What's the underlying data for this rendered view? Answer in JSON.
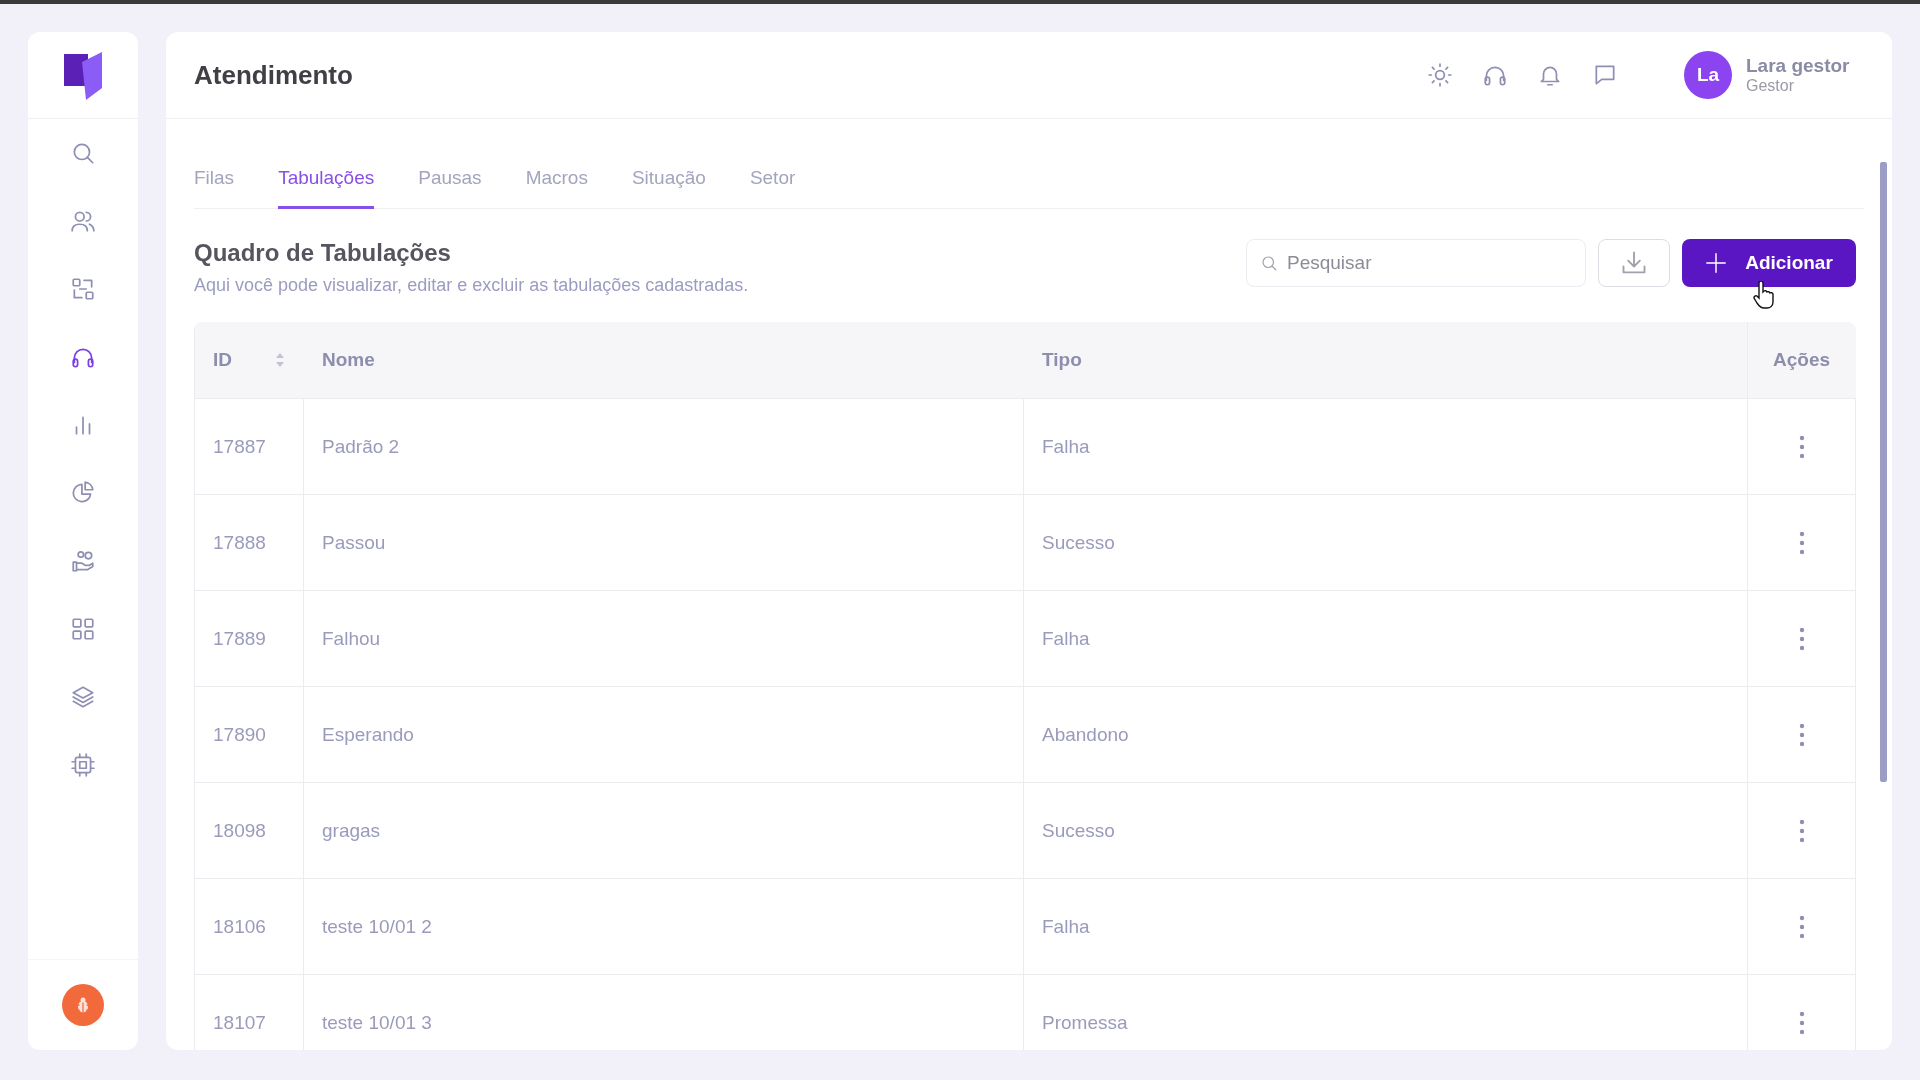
{
  "sidebar": {
    "items": [
      {
        "selected": false
      },
      {
        "selected": false
      },
      {
        "selected": false
      },
      {
        "selected": true
      },
      {
        "selected": false
      },
      {
        "selected": false
      },
      {
        "selected": false
      },
      {
        "selected": false
      },
      {
        "selected": false
      },
      {
        "selected": false
      }
    ]
  },
  "header": {
    "title": "Atendimento",
    "user": {
      "initials": "La",
      "name": "Lara gestor",
      "role": "Gestor"
    }
  },
  "tabs": [
    {
      "label": "Filas",
      "selected": false
    },
    {
      "label": "Tabulações",
      "selected": true
    },
    {
      "label": "Pausas",
      "selected": false
    },
    {
      "label": "Macros",
      "selected": false
    },
    {
      "label": "Situação",
      "selected": false
    },
    {
      "label": "Setor",
      "selected": false
    }
  ],
  "section": {
    "title": "Quadro de Tabulações",
    "subtitle": "Aqui você pode visualizar, editar e excluir as tabulações cadastradas.",
    "search": {
      "placeholder": "Pesquisar"
    },
    "add_button": "Adicionar"
  },
  "table": {
    "columns": [
      "ID",
      "Nome",
      "Tipo",
      "Ações"
    ],
    "rows": [
      {
        "id": "17887",
        "nome": "Padrão 2",
        "tipo": "Falha"
      },
      {
        "id": "17888",
        "nome": "Passou",
        "tipo": "Sucesso"
      },
      {
        "id": "17889",
        "nome": "Falhou",
        "tipo": "Falha"
      },
      {
        "id": "17890",
        "nome": "Esperando",
        "tipo": "Abandono"
      },
      {
        "id": "18098",
        "nome": "gragas",
        "tipo": "Sucesso"
      },
      {
        "id": "18106",
        "nome": "teste 10/01 2",
        "tipo": "Falha"
      },
      {
        "id": "18107",
        "nome": "teste 10/01 3",
        "tipo": "Promessa"
      }
    ]
  }
}
